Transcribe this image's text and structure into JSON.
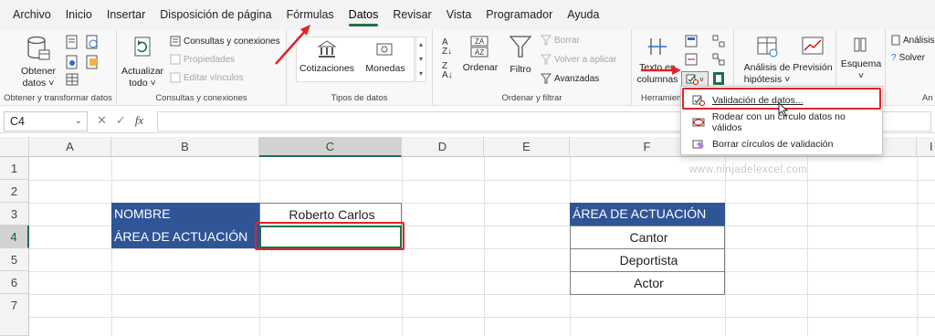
{
  "menu": {
    "items": [
      "Archivo",
      "Inicio",
      "Insertar",
      "Disposición de página",
      "Fórmulas",
      "Datos",
      "Revisar",
      "Vista",
      "Programador",
      "Ayuda"
    ],
    "active": "Datos"
  },
  "ribbon": {
    "get_data": {
      "line1": "Obtener",
      "line2": "datos ˅",
      "group": "Obtener y transformar datos"
    },
    "refresh": {
      "line1": "Actualizar",
      "line2": "todo ˅"
    },
    "queries": {
      "item1": "Consultas y conexiones",
      "item2": "Propiedades",
      "item3": "Editar vínculos",
      "group": "Consultas y conexiones"
    },
    "datatypes": {
      "item1": "Cotizaciones",
      "item2": "Monedas",
      "group": "Tipos de datos"
    },
    "sort": {
      "sort_label": "Ordenar",
      "filter_label": "Filtro",
      "clear": "Borrar",
      "reapply": "Volver a aplicar",
      "advanced": "Avanzadas",
      "group": "Ordenar y filtrar"
    },
    "tools": {
      "text_cols_1": "Texto en",
      "text_cols_2": "columnas",
      "group": "Herramien"
    },
    "forecast": {
      "whatif_1": "Análisis de",
      "whatif_2": "hipótesis ˅",
      "forecast_sheet": "Previsión"
    },
    "outline": {
      "label": "Esquema",
      "chev": "˅"
    },
    "analysis": {
      "item1": "Análisis",
      "item2": "Solver",
      "group": "An"
    }
  },
  "dropdown": {
    "item1": "Validación de datos...",
    "item2": "Rodear con un círculo datos no válidos",
    "item3": "Borrar círculos de validación"
  },
  "formula_bar": {
    "name_box": "C4",
    "fx": "fx",
    "value": ""
  },
  "columns": [
    "A",
    "B",
    "C",
    "D",
    "E",
    "F",
    "I"
  ],
  "rows": [
    "1",
    "2",
    "3",
    "4",
    "5",
    "6",
    "7"
  ],
  "cells": {
    "b3": "NOMBRE",
    "c3": "Roberto Carlos",
    "b4": "ÁREA DE ACTUACIÓN",
    "c4": "",
    "f3": "ÁREA DE ACTUACIÓN",
    "f4": "Cantor",
    "f5": "Deportista",
    "f6": "Actor"
  },
  "watermark": "www.ninjadelexcel.com",
  "colors": {
    "header_blue": "#2f5597",
    "highlight_red": "#e0242b",
    "excel_green": "#1e7145"
  }
}
